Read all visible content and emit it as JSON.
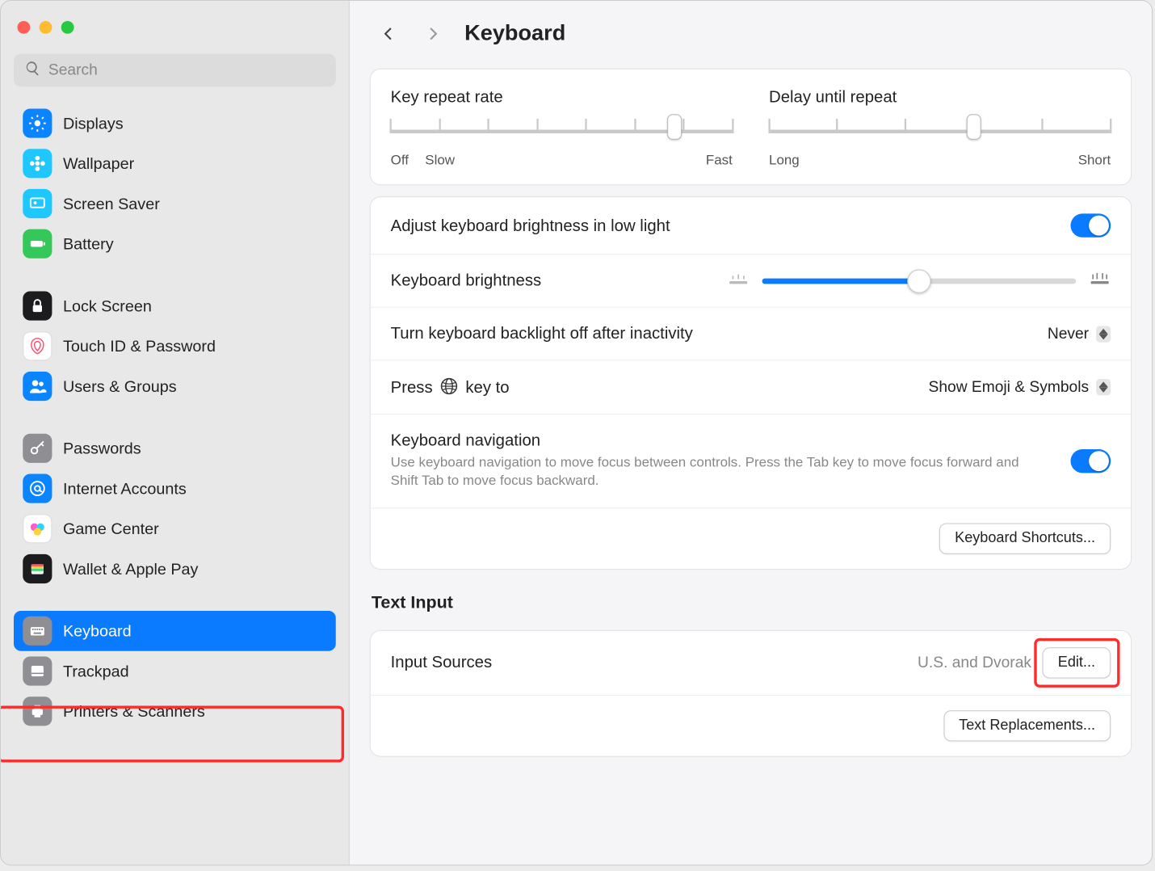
{
  "search": {
    "placeholder": "Search"
  },
  "sidebar": {
    "items": [
      {
        "label": "Displays",
        "bg": "#0a84ff",
        "icon": "sun"
      },
      {
        "label": "Wallpaper",
        "bg": "#1ec8ff",
        "icon": "flower"
      },
      {
        "label": "Screen Saver",
        "bg": "#1ec8ff",
        "icon": "screen"
      },
      {
        "label": "Battery",
        "bg": "#34c759",
        "icon": "battery"
      },
      {
        "label": "Lock Screen",
        "bg": "#1c1c1e",
        "icon": "lock"
      },
      {
        "label": "Touch ID & Password",
        "bg": "#ffffff",
        "icon": "fingerprint"
      },
      {
        "label": "Users & Groups",
        "bg": "#0a84ff",
        "icon": "users"
      },
      {
        "label": "Passwords",
        "bg": "#8e8e93",
        "icon": "key"
      },
      {
        "label": "Internet Accounts",
        "bg": "#0a84ff",
        "icon": "at"
      },
      {
        "label": "Game Center",
        "bg": "#ffffff",
        "icon": "gamecenter"
      },
      {
        "label": "Wallet & Apple Pay",
        "bg": "#1c1c1e",
        "icon": "wallet"
      },
      {
        "label": "Keyboard",
        "bg": "#8e8e93",
        "icon": "keyboard",
        "selected": true
      },
      {
        "label": "Trackpad",
        "bg": "#8e8e93",
        "icon": "trackpad"
      },
      {
        "label": "Printers & Scanners",
        "bg": "#8e8e93",
        "icon": "printer"
      }
    ]
  },
  "header": {
    "title": "Keyboard"
  },
  "sliders": {
    "repeat": {
      "title": "Key repeat rate",
      "labels": [
        "Off",
        "Slow",
        "Fast"
      ],
      "ticks": 8,
      "pos_pct": 83
    },
    "delay": {
      "title": "Delay until repeat",
      "labels": [
        "Long",
        "Short"
      ],
      "ticks": 6,
      "pos_pct": 60
    }
  },
  "rows": {
    "adjust_brightness": "Adjust keyboard brightness in low light",
    "kb_brightness": "Keyboard brightness",
    "kb_brightness_pct": 50,
    "backlight_off": "Turn keyboard backlight off after inactivity",
    "backlight_value": "Never",
    "press_globe_pre": "Press",
    "press_globe_post": "key to",
    "press_globe_value": "Show Emoji & Symbols",
    "kb_nav": "Keyboard navigation",
    "kb_nav_sub": "Use keyboard navigation to move focus between controls. Press the Tab key to move focus forward and Shift Tab to move focus backward.",
    "shortcuts_btn": "Keyboard Shortcuts..."
  },
  "text_input": {
    "header": "Text Input",
    "input_sources": "Input Sources",
    "input_value": "U.S. and Dvorak",
    "edit_btn": "Edit...",
    "replacements_btn": "Text Replacements..."
  }
}
